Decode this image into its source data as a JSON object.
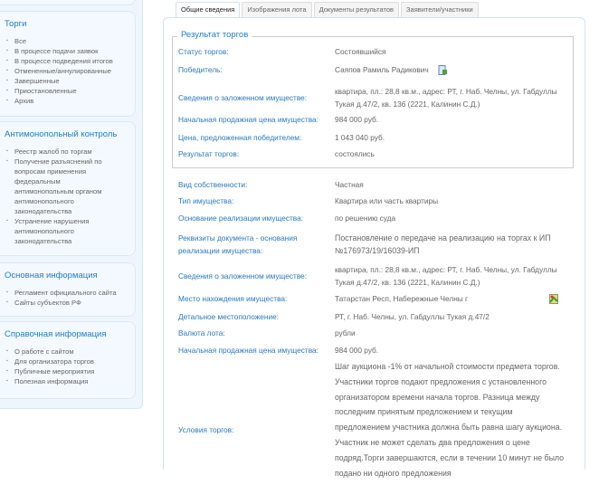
{
  "sidebar": {
    "sections": [
      {
        "title": "Торги",
        "items": [
          "Все",
          "В процессе подачи заявок",
          "В процессе подведения итогов",
          "Отмененные/аннулированные",
          "Завершенные",
          "Приостановленные",
          "Архив"
        ]
      },
      {
        "title": "Антимонопольный контроль",
        "items": [
          "Реестр жалоб по торгам",
          "Получение разъяснений по вопросам применения федеральным антимонопольным органом антимонопольного законодательства",
          "Устранение нарушения антимонопольного законодательства"
        ]
      },
      {
        "title": "Основная информация",
        "items": [
          "Регламент официального сайта",
          "Сайты субъектов РФ"
        ]
      },
      {
        "title": "Справочная информация",
        "items": [
          "О работе с сайтом",
          "Для организатора торгов",
          "Публичные мероприятия",
          "Полезная информация"
        ]
      }
    ]
  },
  "tabs": [
    "Общие сведения",
    "Изображения лота",
    "Документы результатов",
    "Заявители/участники"
  ],
  "result": {
    "title": "Результат торгов",
    "rows": [
      {
        "label": "Статус торгов:",
        "value": "Состоявшийся"
      },
      {
        "label": "Победитель:",
        "value": "Саяпов Рамиль Радикович"
      },
      {
        "label": "Сведения о заложенном имуществе:",
        "value": "квартира, пл.: 28,8 кв.м., адрес: РТ, г. Наб. Челны, ул. Габдуллы Тукая д.47/2, кв. 136 (2221, Калинин С.Д.)"
      },
      {
        "label": "Начальная продажная цена имущества:",
        "value": "984 000 руб."
      },
      {
        "label": "Цена, предложенная победителем:",
        "value": "1 043 040 руб."
      },
      {
        "label": "Результат торгов:",
        "value": "состоялись"
      }
    ]
  },
  "details": [
    {
      "label": "Вид собственности:",
      "value": "Частная"
    },
    {
      "label": "Тип имущества:",
      "value": "Квартира или часть квартиры"
    },
    {
      "label": "Основание реализации имущества:",
      "value": "по решению суда"
    },
    {
      "label": "Реквизиты документа - основания реализации имущества:",
      "value": "Постановление о передаче на реализацию на торгах к ИП №176973/19/16039-ИП"
    },
    {
      "label": "Сведения о заложенном имуществе:",
      "value": "квартира, пл.: 28,8 кв.м., адрес: РТ, г. Наб. Челны, ул. Габдуллы Тукая д.47/2, кв. 136 (2221, Калинин С.Д.)"
    },
    {
      "label": "Место нахождения имущества:",
      "value": "Татарстан Респ, Набережные Челны г"
    },
    {
      "label": "Детальное местоположение:",
      "value": "РТ, г. Наб. Челны, ул. Габдуллы Тукая д.47/2"
    },
    {
      "label": "Валюта лота:",
      "value": "рубли"
    },
    {
      "label": "Начальная продажная цена имущества:",
      "value": "984 000 руб."
    },
    {
      "label": "Условия торгов:",
      "value": "Шаг аукциона -1% от начальной стоимости предмета торгов. Участники торгов подают предложения с установленного организатором времени начала торгов. Разница между последним принятым предложением и текущим предложением участника должна быть равна шагу аукциона. Участник не может сделать два предложения о цене подряд.Торги завершаются, если в течении 10 минут не было подано ни одного предложения"
    }
  ]
}
